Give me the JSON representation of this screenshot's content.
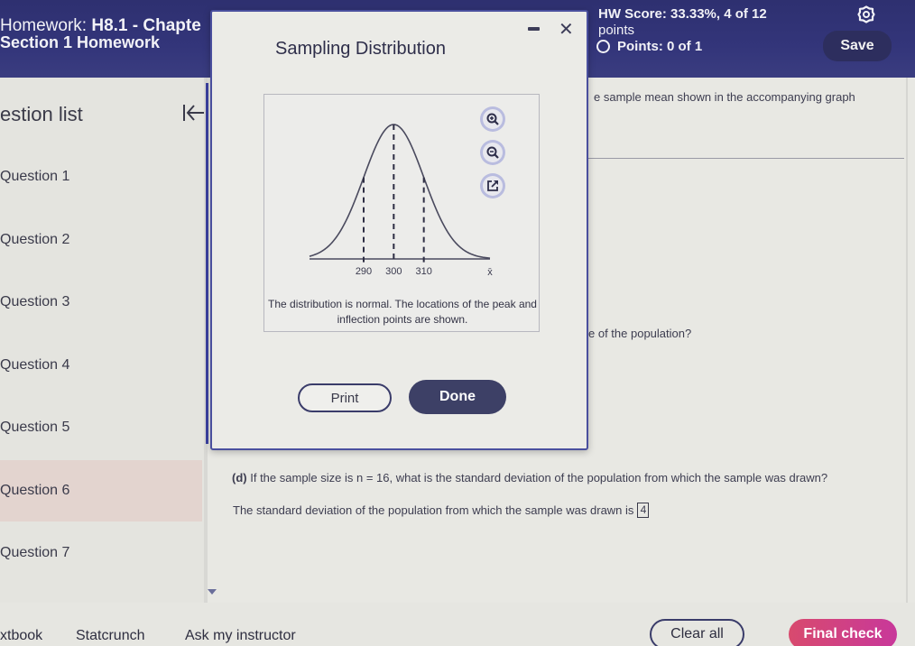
{
  "header": {
    "homework_prefix": "Homework:",
    "homework_title": "H8.1 - Chapte",
    "section": "Section 1 Homework",
    "hw_score": "HW Score: 33.33%, 4 of 12",
    "hw_score_unit": "points",
    "points": "Points: 0 of 1",
    "save_label": "Save",
    "settings_icon": "gear-icon"
  },
  "sidebar": {
    "title": "estion list",
    "collapse_icon": "collapse-left-icon",
    "items": [
      {
        "label": "Question 1",
        "active": false
      },
      {
        "label": "Question 2",
        "active": false
      },
      {
        "label": "Question 3",
        "active": false
      },
      {
        "label": "Question 4",
        "active": false
      },
      {
        "label": "Question 5",
        "active": false
      },
      {
        "label": "Question 6",
        "active": true
      },
      {
        "label": "Question 7",
        "active": false
      }
    ]
  },
  "question": {
    "text_partial_1": "e sample mean shown in the accompanying graph",
    "text_partial_2": "e of the population?",
    "part_d_label": "(d)",
    "part_d_text": "If the sample size is n = 16, what is the standard deviation of the population from which the sample was drawn?",
    "answer_prefix": "The standard deviation of the population from which the sample was drawn is",
    "answer_value": "4"
  },
  "dialog": {
    "title": "Sampling Distribution",
    "minimize_icon": "minimize-icon",
    "close_icon": "close-icon",
    "caption": "The distribution is normal. The locations of the peak and inflection points are shown.",
    "print_label": "Print",
    "done_label": "Done",
    "figure_tools": [
      "zoom-in-icon",
      "zoom-out-icon",
      "open-external-icon"
    ]
  },
  "chart_data": {
    "type": "line",
    "title": "",
    "xlabel": "x̄",
    "ylabel": "",
    "distribution": "normal",
    "mean": 300,
    "std": 10,
    "x_ticks": [
      "290",
      "300",
      "310"
    ],
    "marked_lines": [
      290,
      300,
      310
    ],
    "xlim": [
      272,
      332
    ]
  },
  "footer": {
    "links": [
      "xtbook",
      "Statcrunch",
      "Ask my instructor"
    ],
    "clear_label": "Clear all",
    "final_label": "Final check"
  }
}
